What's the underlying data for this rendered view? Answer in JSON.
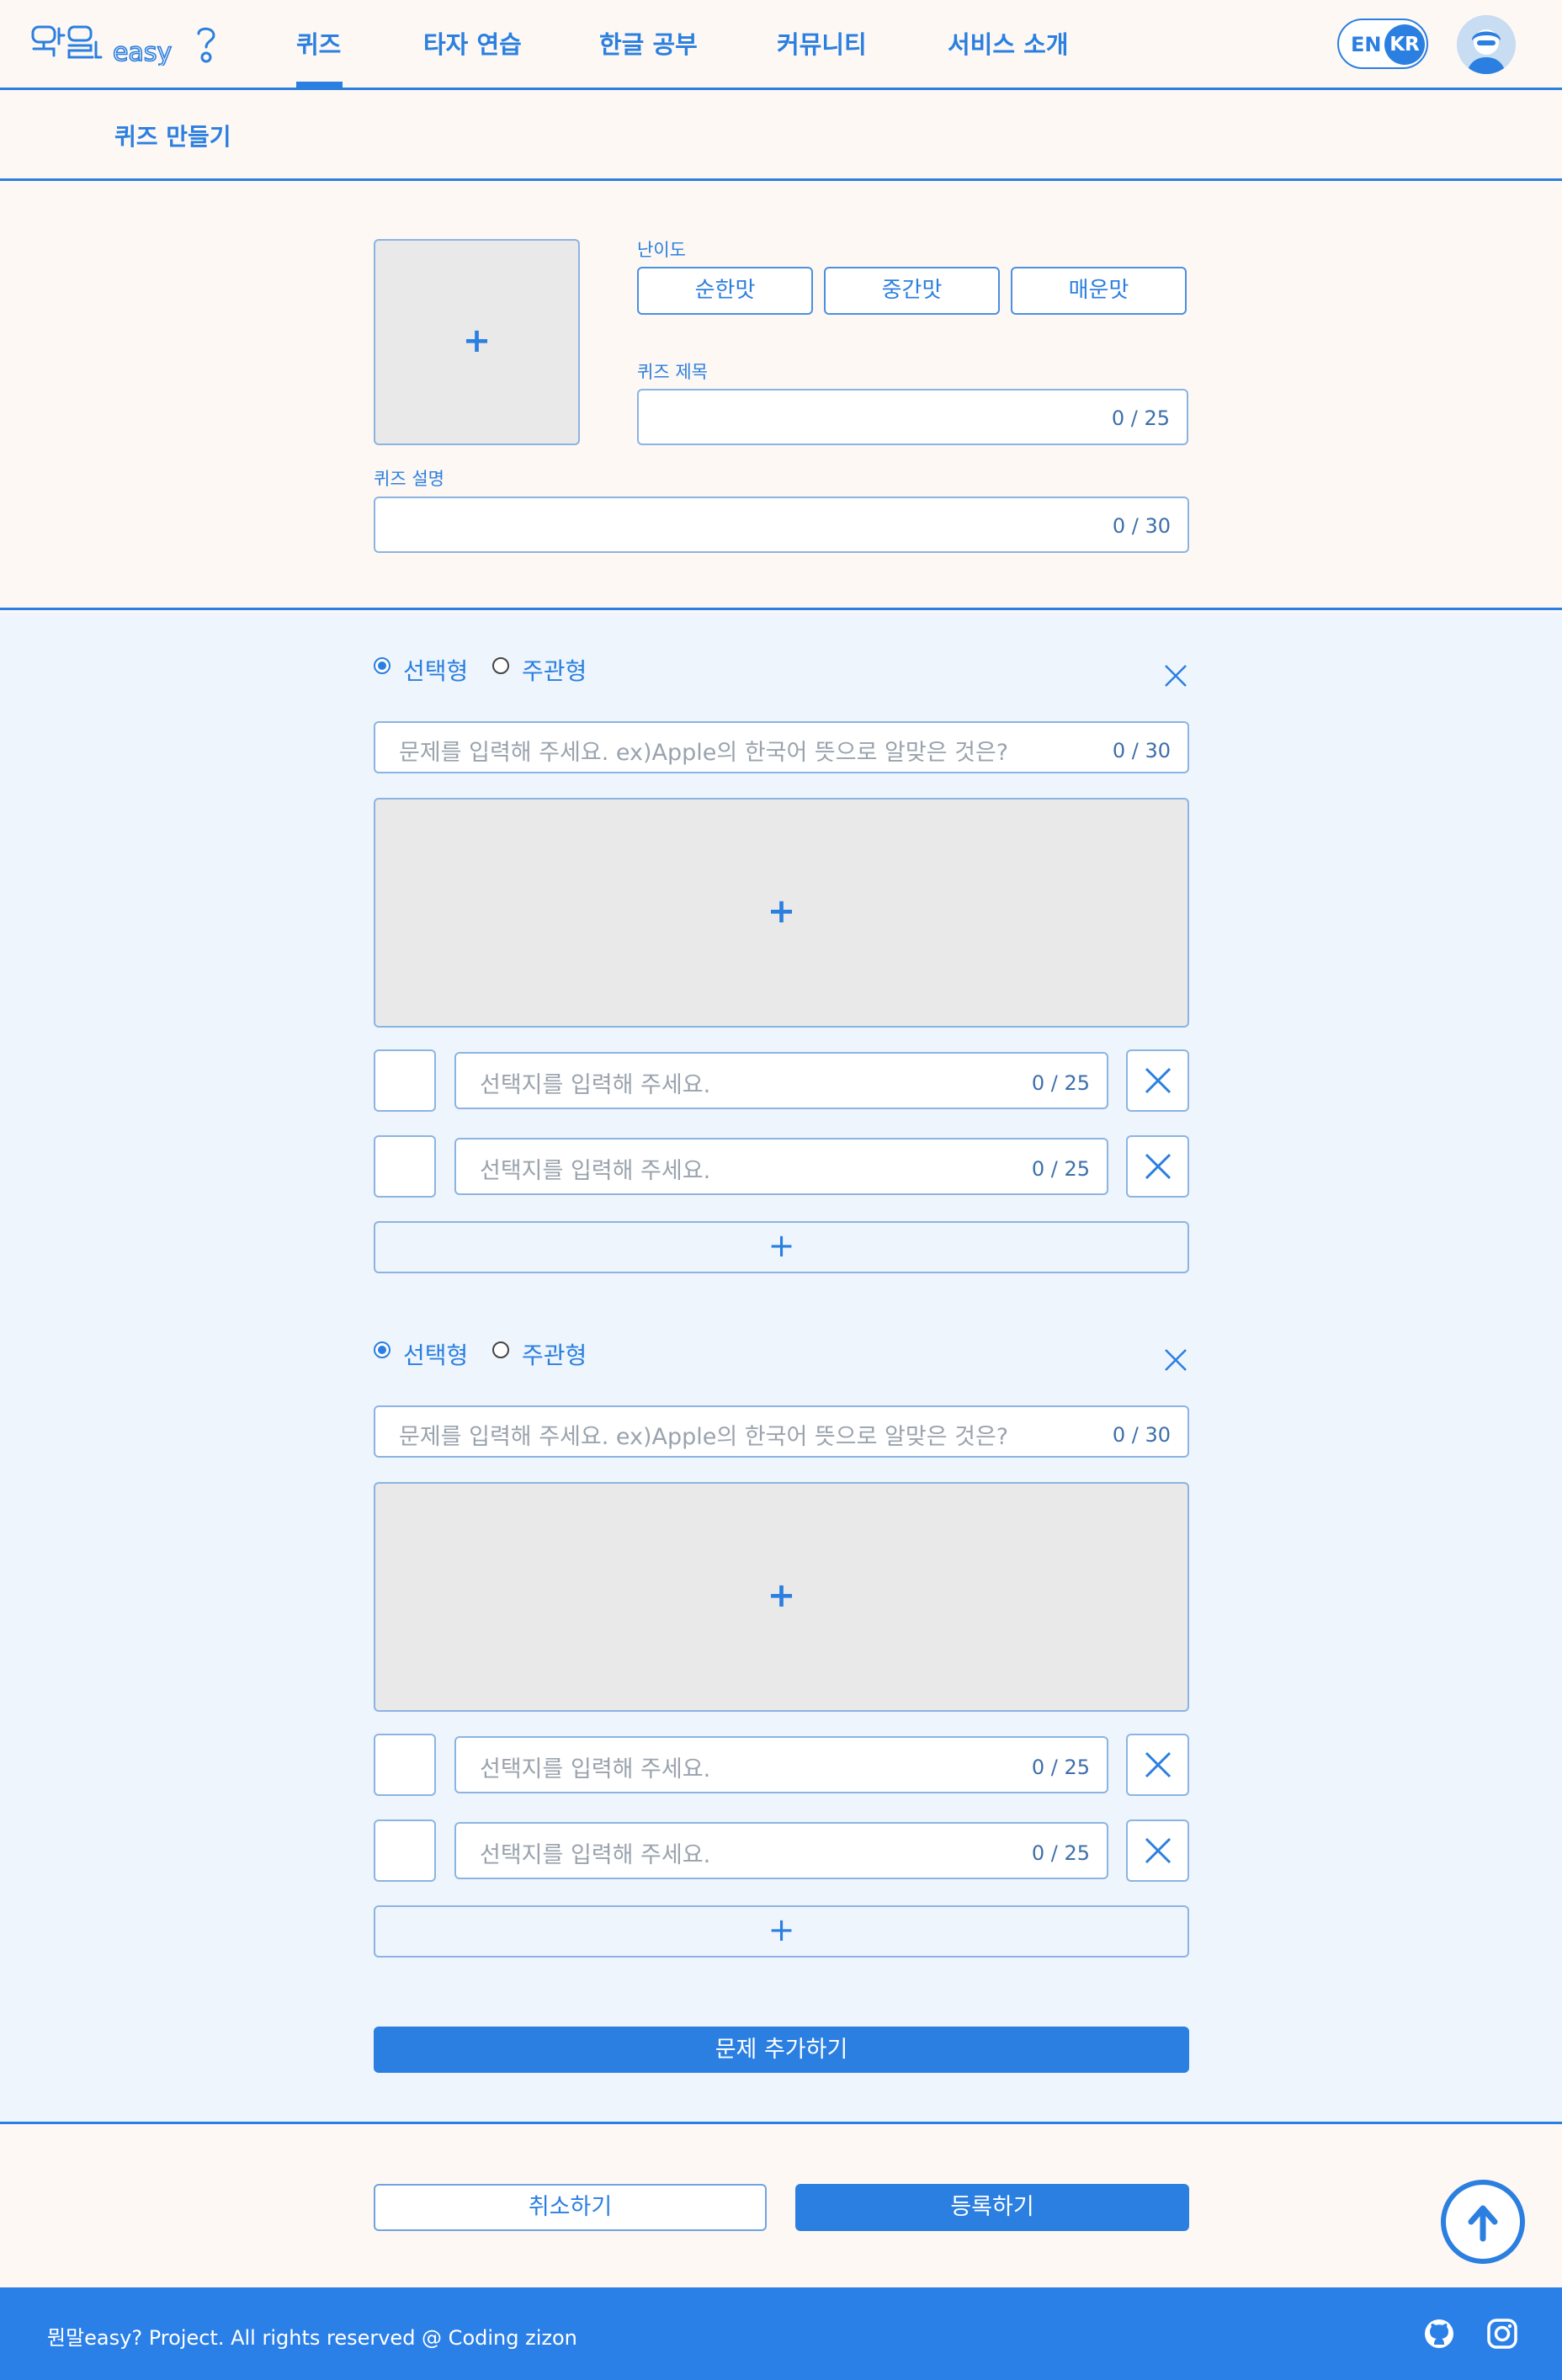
{
  "header": {
    "logo_text": "뭔말easy?",
    "nav": [
      {
        "label": "퀴즈"
      },
      {
        "label": "타자 연습"
      },
      {
        "label": "한글 공부"
      },
      {
        "label": "커뮤니티"
      },
      {
        "label": "서비스 소개"
      }
    ],
    "active_nav": "퀴즈",
    "lang": {
      "en": "EN",
      "kr": "KR",
      "selected": "KR"
    }
  },
  "subheader": {
    "title": "퀴즈 만들기"
  },
  "quiz_meta": {
    "thumbnail_add": "+",
    "difficulty_label": "난이도",
    "difficulty_options": [
      "순한맛",
      "중간맛",
      "매운맛"
    ],
    "title_label": "퀴즈 제목",
    "title_value": "",
    "title_counter": "0 / 25",
    "desc_label": "퀴즈 설명",
    "desc_value": "",
    "desc_counter": "0 / 30"
  },
  "questions": [
    {
      "type_options": [
        "선택형",
        "주관형"
      ],
      "selected_type": "선택형",
      "question_placeholder": "문제를 입력해 주세요. ex)Apple의 한국어 뜻으로 알맞은 것은?",
      "question_counter": "0 / 30",
      "image_add": "+",
      "choices": [
        {
          "placeholder": "선택지를 입력해 주세요.",
          "counter": "0 / 25"
        },
        {
          "placeholder": "선택지를 입력해 주세요.",
          "counter": "0 / 25"
        }
      ],
      "add_choice": "+"
    },
    {
      "type_options": [
        "선택형",
        "주관형"
      ],
      "selected_type": "선택형",
      "question_placeholder": "문제를 입력해 주세요. ex)Apple의 한국어 뜻으로 알맞은 것은?",
      "question_counter": "0 / 30",
      "image_add": "+",
      "choices": [
        {
          "placeholder": "선택지를 입력해 주세요.",
          "counter": "0 / 25"
        },
        {
          "placeholder": "선택지를 입력해 주세요.",
          "counter": "0 / 25"
        }
      ],
      "add_choice": "+"
    }
  ],
  "add_question_label": "문제 추가하기",
  "actions": {
    "cancel": "취소하기",
    "submit": "등록하기"
  },
  "footer": {
    "copyright": "뭔말easy? Project. All rights reserved @ Coding zizon",
    "icons": [
      "github-icon",
      "instagram-icon"
    ]
  },
  "colors": {
    "accent": "#2b7fe0",
    "page_bg": "#fdf8f3",
    "question_bg": "#eef5fd",
    "box_bg": "#e9e9e9"
  }
}
